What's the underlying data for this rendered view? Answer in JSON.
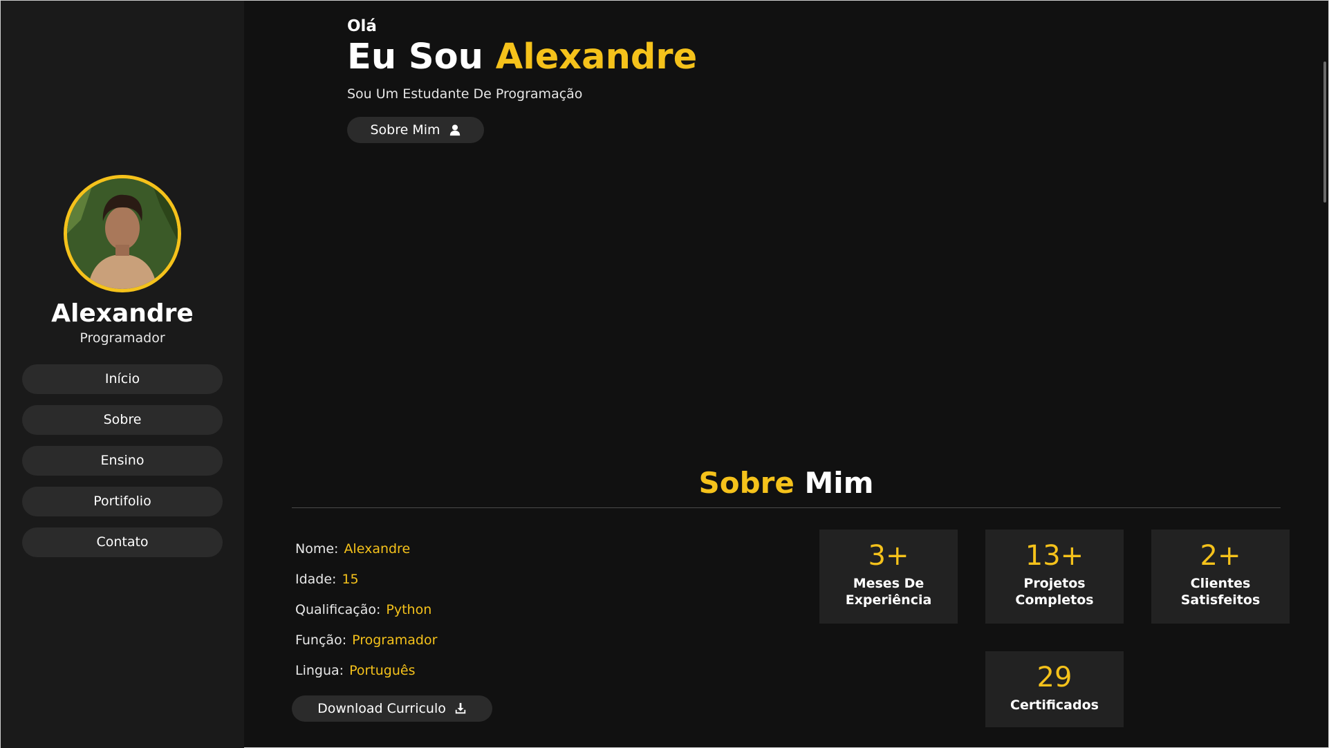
{
  "sidebar": {
    "name": "Alexandre",
    "role": "Programador",
    "nav": [
      {
        "label": "Início"
      },
      {
        "label": "Sobre"
      },
      {
        "label": "Ensino"
      },
      {
        "label": "Portifolio"
      },
      {
        "label": "Contato"
      }
    ]
  },
  "hero": {
    "greeting": "Olá",
    "title_prefix": "Eu Sou",
    "title_name": "Alexandre",
    "subtitle": "Sou Um Estudante De Programação",
    "button_label": "Sobre Mim",
    "button_icon": "user-icon"
  },
  "about": {
    "title_accent": "Sobre",
    "title_rest": "Mim",
    "info": [
      {
        "key": "Nome:",
        "value": "Alexandre"
      },
      {
        "key": "Idade:",
        "value": "15"
      },
      {
        "key": "Qualificação:",
        "value": "Python"
      },
      {
        "key": "Função:",
        "value": "Programador"
      },
      {
        "key": "Lingua:",
        "value": "Português"
      }
    ],
    "download_label": "Download Curriculo",
    "download_icon": "download-icon",
    "stats": [
      {
        "number": "3+",
        "label": "Meses De Experiência"
      },
      {
        "number": "13+",
        "label": "Projetos Completos"
      },
      {
        "number": "2+",
        "label": "Clientes Satisfeitos"
      },
      {
        "number": "29",
        "label": "Certificados"
      }
    ]
  },
  "colors": {
    "accent": "#f5c21b",
    "background": "#111111",
    "sidebar": "#1a1a1a",
    "button": "#2b2b2b",
    "card": "#222222"
  }
}
